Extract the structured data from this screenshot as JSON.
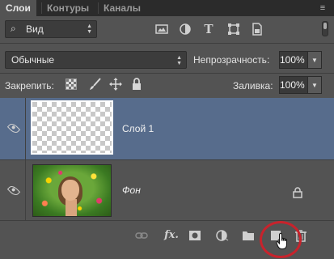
{
  "tabs": [
    {
      "label": "Слои",
      "active": true
    },
    {
      "label": "Контуры",
      "active": false
    },
    {
      "label": "Каналы",
      "active": false
    }
  ],
  "filter": {
    "kind_label": "Вид",
    "icons": [
      "image-filter-icon",
      "adjustment-filter-icon",
      "type-filter-icon",
      "shape-filter-icon",
      "smart-object-filter-icon"
    ]
  },
  "blend": {
    "mode": "Обычные",
    "opacity_label": "Непрозрачность:",
    "opacity_value": "100%"
  },
  "lock": {
    "label": "Закрепить:",
    "fill_label": "Заливка:",
    "fill_value": "100%"
  },
  "layers": [
    {
      "name": "Слой 1",
      "selected": true,
      "visible": true,
      "locked": false
    },
    {
      "name": "Фон",
      "selected": false,
      "visible": true,
      "locked": true
    }
  ],
  "bottom_icons": [
    "link-layers-icon",
    "fx-icon",
    "add-mask-icon",
    "adjustment-layer-icon",
    "new-group-icon",
    "new-layer-icon",
    "delete-layer-icon"
  ],
  "colors": {
    "selection": "#576c8c",
    "highlight": "#c8232c",
    "panel": "#535353"
  }
}
